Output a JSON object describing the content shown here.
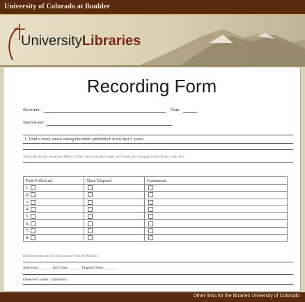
{
  "header": {
    "university": "University of Colorado at Boulder",
    "logo_part1": "University",
    "logo_part2": "Libraries"
  },
  "form": {
    "title": "Recording Form",
    "recorder_label": "Recorder:",
    "date_label": "Date:",
    "interviewer_label": "Interviewer:",
    "question1": "1. Find a book about eating disorders published in the last 5 years.",
    "question2": "What path did the researcher follow? (Note: the researcher's steps, and where they navigate on the library web site.)",
    "table_headers": [
      "Path Followed",
      "Time Elapsed",
      "Comments"
    ],
    "rows": [
      "1.",
      "2.",
      "3.",
      "4.",
      "5.",
      "6.",
      "7.",
      "8."
    ],
    "q3": "Did the researcher find the resource? Yes No Partially",
    "time_line": "Start time: ______  End Time: ______  Elapsed Time: ______",
    "notes_label": "Observer's notes / comments"
  },
  "footer": {
    "text": "Other links for the libraries University of Colorado"
  }
}
